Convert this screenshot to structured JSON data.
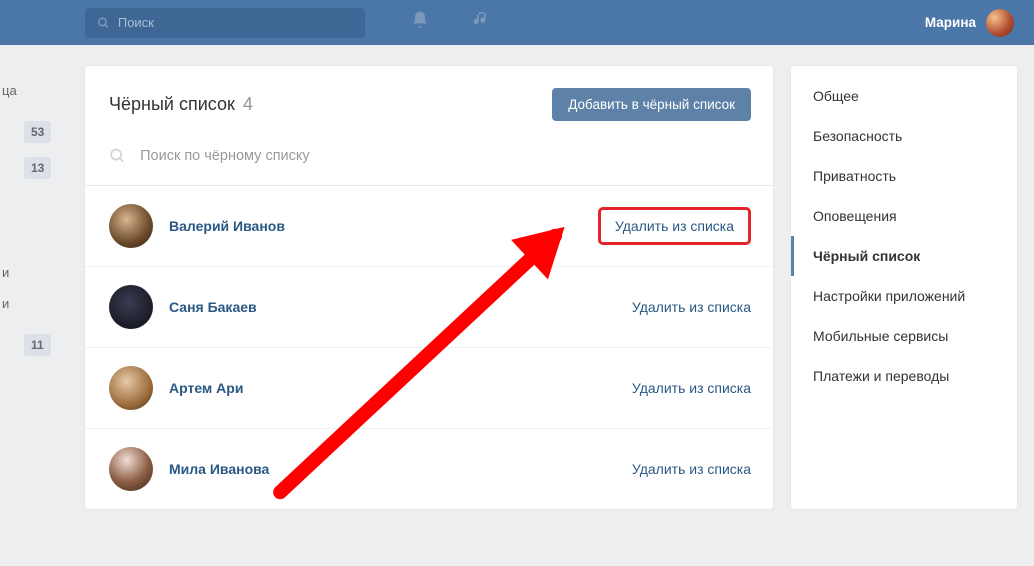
{
  "topbar": {
    "search_placeholder": "Поиск",
    "username": "Марина"
  },
  "left_stub": {
    "item0": "ца",
    "badge0": "53",
    "badge1": "13",
    "item1": "и",
    "item2": "и",
    "badge2": "11"
  },
  "main": {
    "title": "Чёрный список",
    "count": "4",
    "add_button": "Добавить в чёрный список",
    "filter_placeholder": "Поиск по чёрному списку"
  },
  "blacklist": [
    {
      "name": "Валерий Иванов",
      "action": "Удалить из списка"
    },
    {
      "name": "Саня Бакаев",
      "action": "Удалить из списка"
    },
    {
      "name": "Артем Ари",
      "action": "Удалить из списка"
    },
    {
      "name": "Мила Иванова",
      "action": "Удалить из списка"
    }
  ],
  "sidebar": {
    "items": [
      {
        "label": "Общее"
      },
      {
        "label": "Безопасность"
      },
      {
        "label": "Приватность"
      },
      {
        "label": "Оповещения"
      },
      {
        "label": "Чёрный список",
        "active": true
      },
      {
        "label": "Настройки приложений"
      },
      {
        "label": "Мобильные сервисы"
      },
      {
        "label": "Платежи и переводы"
      }
    ]
  }
}
